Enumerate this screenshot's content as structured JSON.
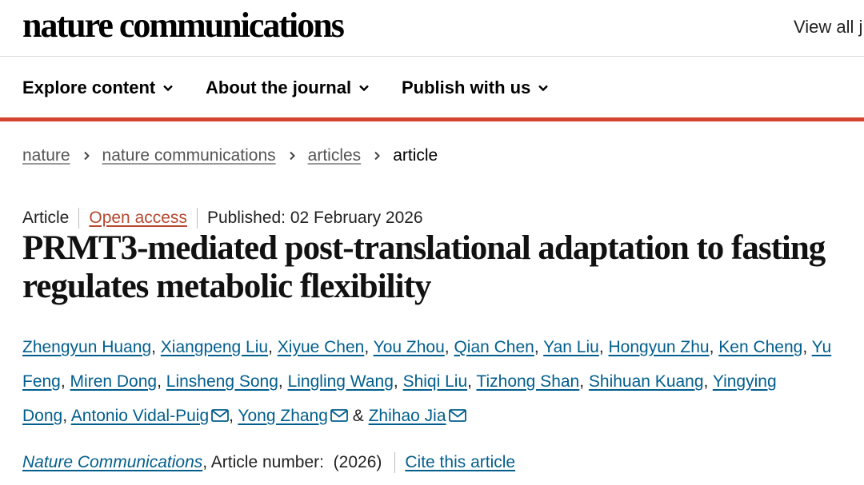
{
  "header": {
    "logo_text": "nature communications",
    "view_all_label": "View all j"
  },
  "nav": {
    "items": [
      {
        "label": "Explore content",
        "icon": "chevron-down-icon"
      },
      {
        "label": "About the journal",
        "icon": "chevron-down-icon"
      },
      {
        "label": "Publish with us",
        "icon": "chevron-down-icon"
      }
    ]
  },
  "breadcrumb": {
    "items": [
      "nature",
      "nature communications",
      "articles"
    ],
    "current": "article",
    "separator_icon": "chevron-right-icon"
  },
  "meta": {
    "type": "Article",
    "access": "Open access",
    "published": "Published: 02 February 2026"
  },
  "title": "PRMT3-mediated post-translational adaptation to fasting regulates metabolic flexibility",
  "authors": [
    {
      "name": "Zhengyun Huang",
      "sep": ", ",
      "email": false
    },
    {
      "name": "Xiangpeng Liu",
      "sep": ", ",
      "email": false
    },
    {
      "name": "Xiyue Chen",
      "sep": ", ",
      "email": false
    },
    {
      "name": "You Zhou",
      "sep": ", ",
      "email": false
    },
    {
      "name": "Qian Chen",
      "sep": ", ",
      "email": false
    },
    {
      "name": "Yan Liu",
      "sep": ", ",
      "email": false
    },
    {
      "name": "Hongyun Zhu",
      "sep": ", ",
      "email": false
    },
    {
      "name": "Ken Cheng",
      "sep": ", ",
      "email": false
    },
    {
      "name": "Yu Feng",
      "sep": ", ",
      "email": false
    },
    {
      "name": "Miren Dong",
      "sep": ", ",
      "email": false
    },
    {
      "name": "Linsheng Song",
      "sep": ", ",
      "email": false
    },
    {
      "name": "Lingling Wang",
      "sep": ", ",
      "email": false
    },
    {
      "name": "Shiqi Liu",
      "sep": ", ",
      "email": false
    },
    {
      "name": "Tizhong Shan",
      "sep": ", ",
      "email": false
    },
    {
      "name": "Shihuan Kuang",
      "sep": ", ",
      "email": false
    },
    {
      "name": "Yingying Dong",
      "sep": ", ",
      "email": false
    },
    {
      "name": "Antonio Vidal-Puig",
      "sep": ", ",
      "email": true
    },
    {
      "name": "Yong Zhang",
      "sep": " & ",
      "email": true
    },
    {
      "name": "Zhihao Jia",
      "sep": "",
      "email": true
    }
  ],
  "citation": {
    "journal": "Nature Communications",
    "article_number_text": ", Article number:  (2026)",
    "cite_label": "Cite this article"
  },
  "colors": {
    "link": "#025e8d",
    "open_access": "#b5482f",
    "accent_bar": "#d5432f"
  }
}
